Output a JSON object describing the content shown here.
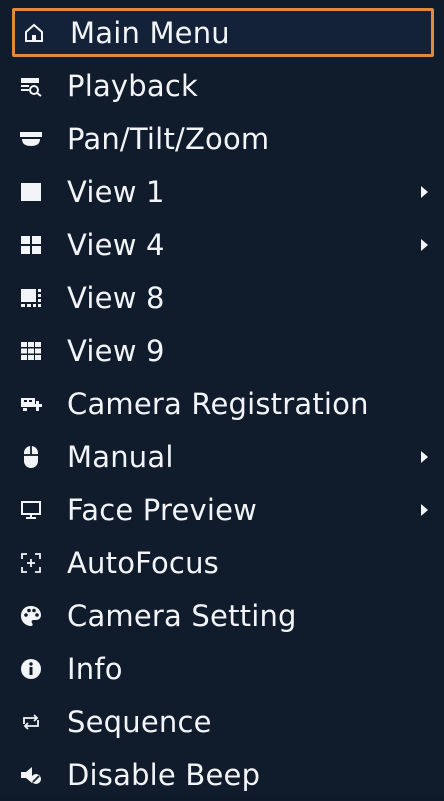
{
  "menu": {
    "items": [
      {
        "label": "Main Menu",
        "icon": "home-icon",
        "selected": true,
        "submenu": false
      },
      {
        "label": "Playback",
        "icon": "playback-icon",
        "selected": false,
        "submenu": false
      },
      {
        "label": "Pan/Tilt/Zoom",
        "icon": "ptz-camera-icon",
        "selected": false,
        "submenu": false
      },
      {
        "label": "View 1",
        "icon": "view-1-icon",
        "selected": false,
        "submenu": true
      },
      {
        "label": "View 4",
        "icon": "view-4-icon",
        "selected": false,
        "submenu": true
      },
      {
        "label": "View 8",
        "icon": "view-8-icon",
        "selected": false,
        "submenu": false
      },
      {
        "label": "View 9",
        "icon": "view-9-icon",
        "selected": false,
        "submenu": false
      },
      {
        "label": "Camera Registration",
        "icon": "camera-registration-icon",
        "selected": false,
        "submenu": false
      },
      {
        "label": "Manual",
        "icon": "mouse-icon",
        "selected": false,
        "submenu": true
      },
      {
        "label": "Face Preview",
        "icon": "monitor-icon",
        "selected": false,
        "submenu": true
      },
      {
        "label": "AutoFocus",
        "icon": "autofocus-icon",
        "selected": false,
        "submenu": false
      },
      {
        "label": "Camera Setting",
        "icon": "palette-icon",
        "selected": false,
        "submenu": false
      },
      {
        "label": "Info",
        "icon": "info-icon",
        "selected": false,
        "submenu": false
      },
      {
        "label": "Sequence",
        "icon": "sequence-icon",
        "selected": false,
        "submenu": false
      },
      {
        "label": "Disable Beep",
        "icon": "speaker-mute-icon",
        "selected": false,
        "submenu": false
      }
    ]
  },
  "colors": {
    "background": "#101c2c",
    "text": "#f2f4f7",
    "selection_border": "#e08a3c"
  }
}
